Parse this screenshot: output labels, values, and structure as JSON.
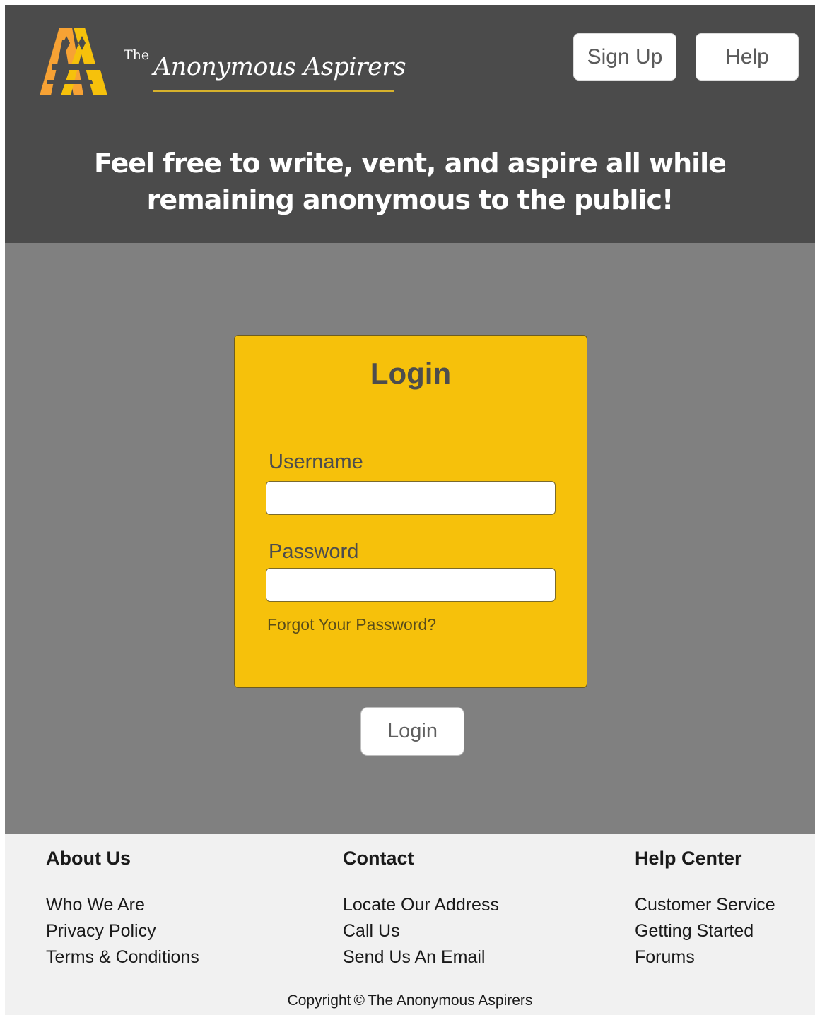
{
  "header": {
    "brand_prefix": "The",
    "brand_name": "Anonymous Aspirers",
    "signup_label": "Sign Up",
    "help_label": "Help",
    "tagline": "Feel free to write, vent, and aspire all while remaining anonymous to the public!",
    "logo_icon": "aa-logo-icon",
    "colors": {
      "header_bg": "#4b4b4b",
      "logo_orange": "#f7a234",
      "logo_yellow": "#f6c10b"
    }
  },
  "login": {
    "title": "Login",
    "username_label": "Username",
    "username_value": "",
    "password_label": "Password",
    "password_value": "",
    "forgot_label": "Forgot Your Password?",
    "submit_label": "Login",
    "colors": {
      "card_bg": "#f6c10b",
      "page_bg": "#808080"
    }
  },
  "footer": {
    "about": {
      "heading": "About Us",
      "links": [
        "Who We Are",
        "Privacy Policy",
        "Terms & Conditions"
      ]
    },
    "contact": {
      "heading": "Contact",
      "links": [
        "Locate Our Address",
        "Call Us",
        "Send Us An Email"
      ]
    },
    "help_center": {
      "heading": "Help Center",
      "links": [
        "Customer Service",
        "Getting Started",
        "Forums"
      ]
    },
    "copyright_prefix": "Copyright",
    "copyright_symbol": "©",
    "copyright_name": "The Anonymous Aspirers",
    "colors": {
      "footer_bg": "#f1f1f1"
    }
  }
}
